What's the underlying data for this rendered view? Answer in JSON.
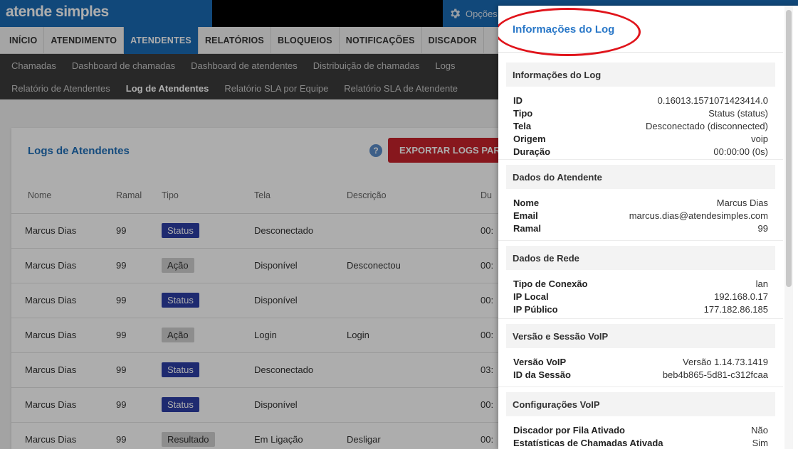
{
  "header": {
    "logo": "atende simples",
    "options_label": "Opções"
  },
  "main_nav": [
    {
      "label": "INÍCIO",
      "active": false
    },
    {
      "label": "ATENDIMENTO",
      "active": false
    },
    {
      "label": "ATENDENTES",
      "active": true
    },
    {
      "label": "RELATÓRIOS",
      "active": false
    },
    {
      "label": "BLOQUEIOS",
      "active": false
    },
    {
      "label": "NOTIFICAÇÕES",
      "active": false
    },
    {
      "label": "DISCADOR",
      "active": false
    }
  ],
  "sub_nav": {
    "row1": [
      "Chamadas",
      "Dashboard de chamadas",
      "Dashboard de atendentes",
      "Distribuição de chamadas",
      "Logs"
    ],
    "row2": [
      "Relatório de Atendentes",
      "Log de Atendentes",
      "Relatório SLA por Equipe",
      "Relatório SLA de Atendente"
    ],
    "active": "Log de Atendentes"
  },
  "card": {
    "title": "Logs de Atendentes",
    "help": "?",
    "export_label": "EXPORTAR LOGS PARA",
    "columns": [
      "Nome",
      "Ramal",
      "Tipo",
      "Tela",
      "Descrição",
      "Du"
    ],
    "rows": [
      {
        "nome": "Marcus Dias",
        "ramal": "99",
        "tipo": "Status",
        "tipo_kind": "status",
        "tela": "Desconectado",
        "descricao": "",
        "dur": "00:"
      },
      {
        "nome": "Marcus Dias",
        "ramal": "99",
        "tipo": "Ação",
        "tipo_kind": "acao",
        "tela": "Disponível",
        "descricao": "Desconectou",
        "dur": "00:"
      },
      {
        "nome": "Marcus Dias",
        "ramal": "99",
        "tipo": "Status",
        "tipo_kind": "status",
        "tela": "Disponível",
        "descricao": "",
        "dur": "00:"
      },
      {
        "nome": "Marcus Dias",
        "ramal": "99",
        "tipo": "Ação",
        "tipo_kind": "acao",
        "tela": "Login",
        "descricao": "Login",
        "dur": "00:"
      },
      {
        "nome": "Marcus Dias",
        "ramal": "99",
        "tipo": "Status",
        "tipo_kind": "status",
        "tela": "Desconectado",
        "descricao": "",
        "dur": "03:"
      },
      {
        "nome": "Marcus Dias",
        "ramal": "99",
        "tipo": "Status",
        "tipo_kind": "status",
        "tela": "Disponível",
        "descricao": "",
        "dur": "00:"
      },
      {
        "nome": "Marcus Dias",
        "ramal": "99",
        "tipo": "Resultado",
        "tipo_kind": "resultado",
        "tela": "Em Ligação",
        "descricao": "Desligar",
        "dur": "00:"
      }
    ]
  },
  "panel": {
    "title": "Informações do Log",
    "sections": [
      {
        "title": "Informações do Log",
        "rows": [
          {
            "k": "ID",
            "v": "0.16013.1571071423414.0"
          },
          {
            "k": "Tipo",
            "v": "Status (status)"
          },
          {
            "k": "Tela",
            "v": "Desconectado (disconnected)"
          },
          {
            "k": "Origem",
            "v": "voip"
          },
          {
            "k": "Duração",
            "v": "00:00:00 (0s)"
          }
        ]
      },
      {
        "title": "Dados do Atendente",
        "rows": [
          {
            "k": "Nome",
            "v": "Marcus Dias"
          },
          {
            "k": "Email",
            "v": "marcus.dias@atendesimples.com"
          },
          {
            "k": "Ramal",
            "v": "99"
          }
        ]
      },
      {
        "title": "Dados de Rede",
        "rows": [
          {
            "k": "Tipo de Conexão",
            "v": "lan"
          },
          {
            "k": "IP Local",
            "v": "192.168.0.17"
          },
          {
            "k": "IP Público",
            "v": "177.182.86.185"
          }
        ]
      },
      {
        "title": "Versão e Sessão VoIP",
        "rows": [
          {
            "k": "Versão VoIP",
            "v": "Versão 1.14.73.1419"
          },
          {
            "k": "ID da Sessão",
            "v": "beb4b865-5d81-c312fcaa"
          }
        ]
      },
      {
        "title": "Configurações VoIP",
        "rows": [
          {
            "k": "Discador por Fila Ativado",
            "v": "Não"
          },
          {
            "k": "Estatísticas de Chamadas Ativada",
            "v": "Sim"
          }
        ]
      }
    ]
  }
}
